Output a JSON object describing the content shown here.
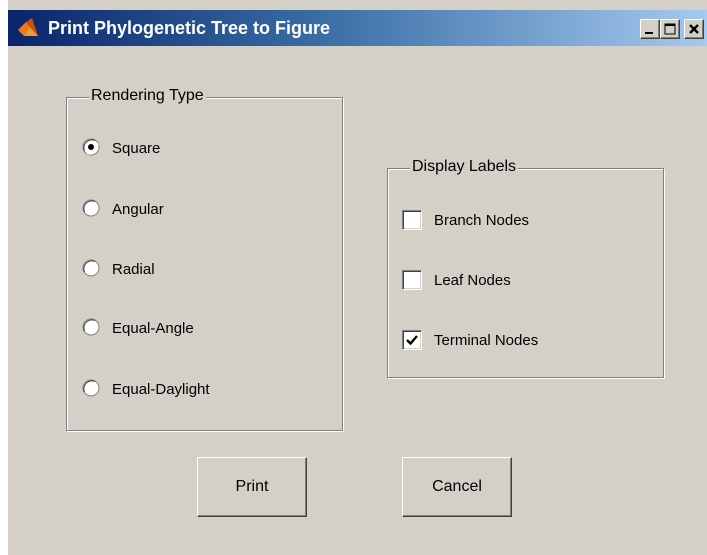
{
  "window": {
    "title": "Print Phylogenetic Tree to Figure"
  },
  "rendering_type": {
    "title": "Rendering Type",
    "options": [
      {
        "label": "Square",
        "selected": true
      },
      {
        "label": "Angular",
        "selected": false
      },
      {
        "label": "Radial",
        "selected": false
      },
      {
        "label": "Equal-Angle",
        "selected": false
      },
      {
        "label": "Equal-Daylight",
        "selected": false
      }
    ]
  },
  "display_labels": {
    "title": "Display Labels",
    "options": [
      {
        "label": "Branch Nodes",
        "checked": false
      },
      {
        "label": "Leaf Nodes",
        "checked": false
      },
      {
        "label": "Terminal Nodes",
        "checked": true
      }
    ]
  },
  "buttons": {
    "print": "Print",
    "cancel": "Cancel"
  },
  "icons": {
    "app": "matlab-icon",
    "minimize": "minimize-icon",
    "maximize": "maximize-icon",
    "close": "close-icon"
  }
}
